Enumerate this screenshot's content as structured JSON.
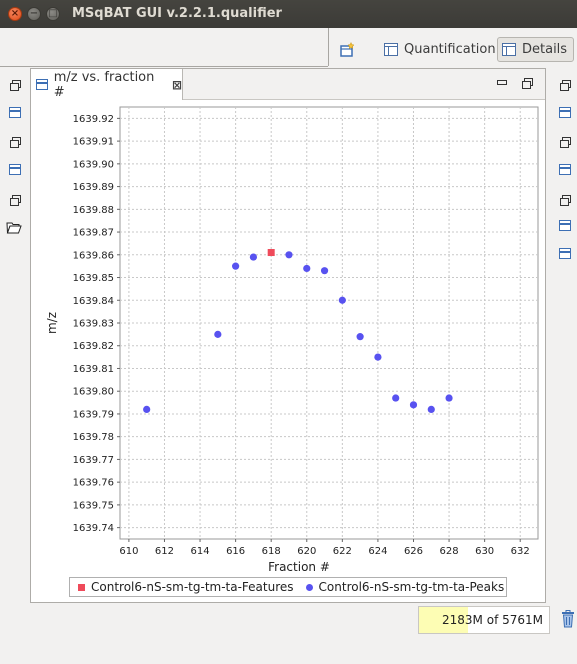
{
  "window": {
    "title": "MSqBAT GUI v.2.2.1.qualifier",
    "controls": [
      "close-icon",
      "minimize-icon",
      "maximize-icon"
    ]
  },
  "toolbar": {
    "open_perspective_icon": "open-perspective-icon",
    "perspectives": [
      {
        "label": "Quantification",
        "icon": "perspective-icon",
        "active": false
      },
      {
        "label": "Details",
        "icon": "perspective-icon",
        "active": true
      }
    ]
  },
  "left_strip": [
    "restore-icon",
    "view-icon",
    "restore-icon",
    "view-icon",
    "restore-icon",
    "open-folder-icon"
  ],
  "right_strip": [
    "restore-icon",
    "view-icon",
    "restore-icon",
    "view-icon",
    "restore-icon",
    "view-icon",
    "view-icon"
  ],
  "view": {
    "tab_label": "m/z vs. fraction #",
    "tab_close": "⊠"
  },
  "colors": {
    "features": "#ef4a5a",
    "peaks": "#5852f0",
    "grid": "#c8c8c8"
  },
  "chart_data": {
    "type": "scatter",
    "xlabel": "Fraction #",
    "ylabel": "m/z",
    "xlim": [
      609.5,
      633
    ],
    "ylim": [
      1639.735,
      1639.925
    ],
    "xticks": [
      610,
      612,
      614,
      616,
      618,
      620,
      622,
      624,
      626,
      628,
      630,
      632
    ],
    "yticks": [
      1639.74,
      1639.75,
      1639.76,
      1639.77,
      1639.78,
      1639.79,
      1639.8,
      1639.81,
      1639.82,
      1639.83,
      1639.84,
      1639.85,
      1639.86,
      1639.87,
      1639.88,
      1639.89,
      1639.9,
      1639.91,
      1639.92
    ],
    "grid": true,
    "legend_position": "bottom",
    "series": [
      {
        "name": "Control6-nS-sm-tg-tm-ta-Features",
        "marker": "square",
        "color": "#ef4a5a",
        "x": [
          618
        ],
        "y": [
          1639.861
        ]
      },
      {
        "name": "Control6-nS-sm-tg-tm-ta-Peaks",
        "marker": "circle",
        "color": "#5852f0",
        "x": [
          611,
          615,
          616,
          617,
          619,
          620,
          621,
          622,
          623,
          624,
          625,
          626,
          627,
          628
        ],
        "y": [
          1639.792,
          1639.825,
          1639.855,
          1639.859,
          1639.86,
          1639.854,
          1639.853,
          1639.84,
          1639.824,
          1639.815,
          1639.797,
          1639.794,
          1639.792,
          1639.797
        ]
      }
    ]
  },
  "status": {
    "memory_text": "2183M of 5761M",
    "memory_used_fraction": 0.379,
    "trash_icon": "trash-icon"
  }
}
